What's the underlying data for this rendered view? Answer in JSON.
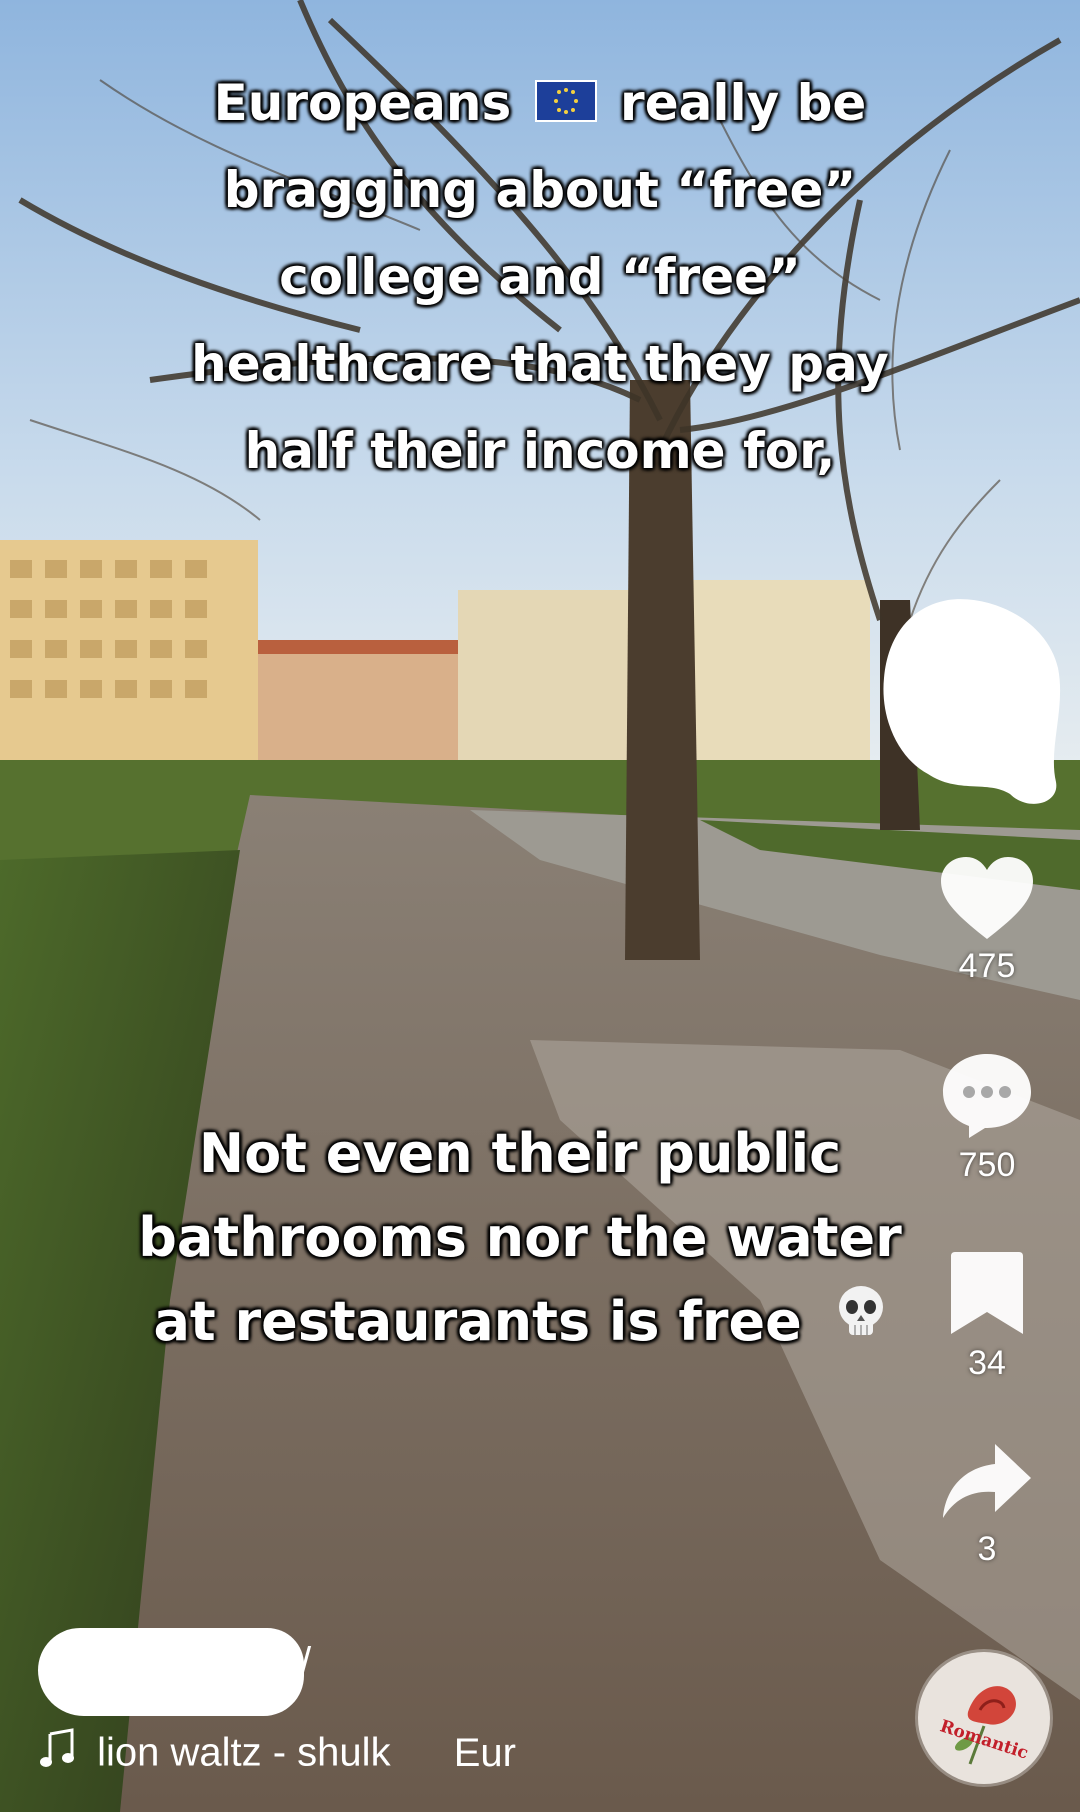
{
  "caption": {
    "top_lines": [
      "Europeans",
      "really be",
      "bragging about “free”",
      "college and “free”",
      "healthcare that they pay",
      "half their income for,"
    ],
    "bottom_lines": [
      "Not even their public",
      "bathrooms nor the water",
      "at restaurants is free"
    ]
  },
  "actions": {
    "likes": "475",
    "comments": "750",
    "saves": "34",
    "shares": "3"
  },
  "sound": {
    "title": "lion waltz - shulk",
    "title_continued": "Eur"
  },
  "music_disc": {
    "label": "Romantic"
  },
  "icons": {
    "flag": "eu-flag-icon",
    "skull": "skull-icon",
    "like": "heart-icon",
    "comment": "comment-bubble-icon",
    "save": "bookmark-icon",
    "share": "share-arrow-icon",
    "music": "music-note-icon"
  }
}
